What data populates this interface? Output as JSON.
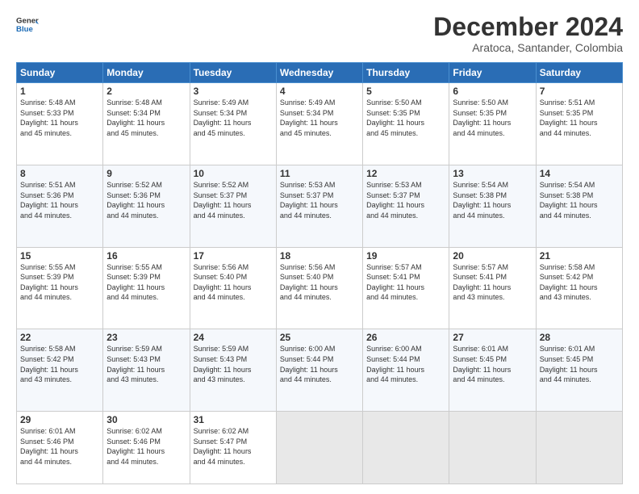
{
  "header": {
    "logo_line1": "General",
    "logo_line2": "Blue",
    "main_title": "December 2024",
    "subtitle": "Aratoca, Santander, Colombia"
  },
  "calendar": {
    "days_of_week": [
      "Sunday",
      "Monday",
      "Tuesday",
      "Wednesday",
      "Thursday",
      "Friday",
      "Saturday"
    ],
    "weeks": [
      [
        {
          "day": 1,
          "info": "Sunrise: 5:48 AM\nSunset: 5:33 PM\nDaylight: 11 hours\nand 45 minutes."
        },
        {
          "day": 2,
          "info": "Sunrise: 5:48 AM\nSunset: 5:34 PM\nDaylight: 11 hours\nand 45 minutes."
        },
        {
          "day": 3,
          "info": "Sunrise: 5:49 AM\nSunset: 5:34 PM\nDaylight: 11 hours\nand 45 minutes."
        },
        {
          "day": 4,
          "info": "Sunrise: 5:49 AM\nSunset: 5:34 PM\nDaylight: 11 hours\nand 45 minutes."
        },
        {
          "day": 5,
          "info": "Sunrise: 5:50 AM\nSunset: 5:35 PM\nDaylight: 11 hours\nand 45 minutes."
        },
        {
          "day": 6,
          "info": "Sunrise: 5:50 AM\nSunset: 5:35 PM\nDaylight: 11 hours\nand 44 minutes."
        },
        {
          "day": 7,
          "info": "Sunrise: 5:51 AM\nSunset: 5:35 PM\nDaylight: 11 hours\nand 44 minutes."
        }
      ],
      [
        {
          "day": 8,
          "info": "Sunrise: 5:51 AM\nSunset: 5:36 PM\nDaylight: 11 hours\nand 44 minutes."
        },
        {
          "day": 9,
          "info": "Sunrise: 5:52 AM\nSunset: 5:36 PM\nDaylight: 11 hours\nand 44 minutes."
        },
        {
          "day": 10,
          "info": "Sunrise: 5:52 AM\nSunset: 5:37 PM\nDaylight: 11 hours\nand 44 minutes."
        },
        {
          "day": 11,
          "info": "Sunrise: 5:53 AM\nSunset: 5:37 PM\nDaylight: 11 hours\nand 44 minutes."
        },
        {
          "day": 12,
          "info": "Sunrise: 5:53 AM\nSunset: 5:37 PM\nDaylight: 11 hours\nand 44 minutes."
        },
        {
          "day": 13,
          "info": "Sunrise: 5:54 AM\nSunset: 5:38 PM\nDaylight: 11 hours\nand 44 minutes."
        },
        {
          "day": 14,
          "info": "Sunrise: 5:54 AM\nSunset: 5:38 PM\nDaylight: 11 hours\nand 44 minutes."
        }
      ],
      [
        {
          "day": 15,
          "info": "Sunrise: 5:55 AM\nSunset: 5:39 PM\nDaylight: 11 hours\nand 44 minutes."
        },
        {
          "day": 16,
          "info": "Sunrise: 5:55 AM\nSunset: 5:39 PM\nDaylight: 11 hours\nand 44 minutes."
        },
        {
          "day": 17,
          "info": "Sunrise: 5:56 AM\nSunset: 5:40 PM\nDaylight: 11 hours\nand 44 minutes."
        },
        {
          "day": 18,
          "info": "Sunrise: 5:56 AM\nSunset: 5:40 PM\nDaylight: 11 hours\nand 44 minutes."
        },
        {
          "day": 19,
          "info": "Sunrise: 5:57 AM\nSunset: 5:41 PM\nDaylight: 11 hours\nand 44 minutes."
        },
        {
          "day": 20,
          "info": "Sunrise: 5:57 AM\nSunset: 5:41 PM\nDaylight: 11 hours\nand 43 minutes."
        },
        {
          "day": 21,
          "info": "Sunrise: 5:58 AM\nSunset: 5:42 PM\nDaylight: 11 hours\nand 43 minutes."
        }
      ],
      [
        {
          "day": 22,
          "info": "Sunrise: 5:58 AM\nSunset: 5:42 PM\nDaylight: 11 hours\nand 43 minutes."
        },
        {
          "day": 23,
          "info": "Sunrise: 5:59 AM\nSunset: 5:43 PM\nDaylight: 11 hours\nand 43 minutes."
        },
        {
          "day": 24,
          "info": "Sunrise: 5:59 AM\nSunset: 5:43 PM\nDaylight: 11 hours\nand 43 minutes."
        },
        {
          "day": 25,
          "info": "Sunrise: 6:00 AM\nSunset: 5:44 PM\nDaylight: 11 hours\nand 44 minutes."
        },
        {
          "day": 26,
          "info": "Sunrise: 6:00 AM\nSunset: 5:44 PM\nDaylight: 11 hours\nand 44 minutes."
        },
        {
          "day": 27,
          "info": "Sunrise: 6:01 AM\nSunset: 5:45 PM\nDaylight: 11 hours\nand 44 minutes."
        },
        {
          "day": 28,
          "info": "Sunrise: 6:01 AM\nSunset: 5:45 PM\nDaylight: 11 hours\nand 44 minutes."
        }
      ],
      [
        {
          "day": 29,
          "info": "Sunrise: 6:01 AM\nSunset: 5:46 PM\nDaylight: 11 hours\nand 44 minutes."
        },
        {
          "day": 30,
          "info": "Sunrise: 6:02 AM\nSunset: 5:46 PM\nDaylight: 11 hours\nand 44 minutes."
        },
        {
          "day": 31,
          "info": "Sunrise: 6:02 AM\nSunset: 5:47 PM\nDaylight: 11 hours\nand 44 minutes."
        },
        null,
        null,
        null,
        null
      ]
    ]
  }
}
